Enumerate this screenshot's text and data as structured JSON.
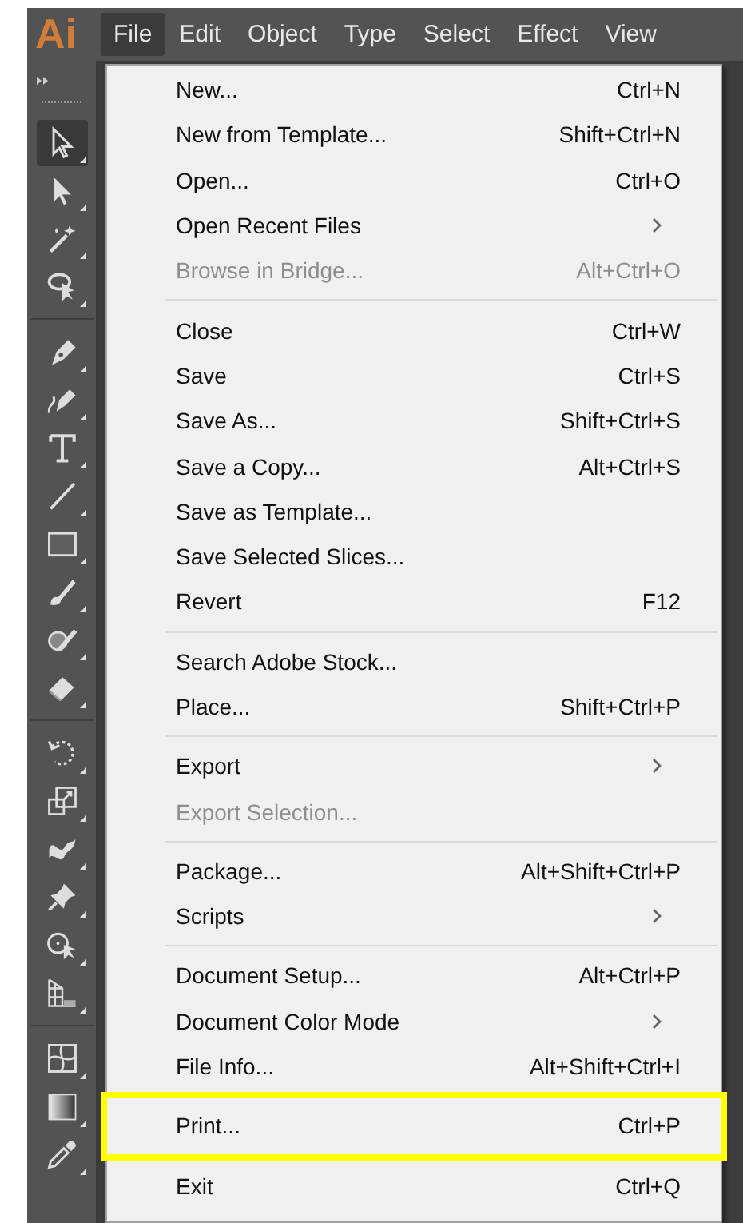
{
  "app_logo": "Ai",
  "menubar": [
    {
      "label": "File",
      "selected": true
    },
    {
      "label": "Edit",
      "selected": false
    },
    {
      "label": "Object",
      "selected": false
    },
    {
      "label": "Type",
      "selected": false
    },
    {
      "label": "Select",
      "selected": false
    },
    {
      "label": "Effect",
      "selected": false
    },
    {
      "label": "View",
      "selected": false
    }
  ],
  "tools": [
    {
      "kind": "selection",
      "selected": true
    },
    {
      "kind": "direct",
      "selected": false
    },
    {
      "kind": "wand",
      "selected": false
    },
    {
      "kind": "lasso",
      "selected": false
    },
    {
      "kind": "sep"
    },
    {
      "kind": "pen",
      "selected": false
    },
    {
      "kind": "curvature",
      "selected": false
    },
    {
      "kind": "type",
      "selected": false
    },
    {
      "kind": "line",
      "selected": false
    },
    {
      "kind": "rect",
      "selected": false
    },
    {
      "kind": "brush",
      "selected": false
    },
    {
      "kind": "shaper",
      "selected": false
    },
    {
      "kind": "eraser",
      "selected": false
    },
    {
      "kind": "sep"
    },
    {
      "kind": "rotate",
      "selected": false
    },
    {
      "kind": "scale",
      "selected": false
    },
    {
      "kind": "warp",
      "selected": false
    },
    {
      "kind": "pin",
      "selected": false
    },
    {
      "kind": "builder",
      "selected": false
    },
    {
      "kind": "perspective",
      "selected": false
    },
    {
      "kind": "sep"
    },
    {
      "kind": "mesh",
      "selected": false
    },
    {
      "kind": "gradient",
      "selected": false
    },
    {
      "kind": "eyedropper",
      "selected": false
    }
  ],
  "file_menu": [
    [
      {
        "label": "New...",
        "shortcut": "Ctrl+N",
        "disabled": false,
        "submenu": false,
        "highlighted": false
      },
      {
        "label": "New from Template...",
        "shortcut": "Shift+Ctrl+N",
        "disabled": false,
        "submenu": false,
        "highlighted": false
      },
      {
        "label": "Open...",
        "shortcut": "Ctrl+O",
        "disabled": false,
        "submenu": false,
        "highlighted": false
      },
      {
        "label": "Open Recent Files",
        "disabled": false,
        "submenu": true,
        "highlighted": false
      },
      {
        "label": "Browse in Bridge...",
        "shortcut": "Alt+Ctrl+O",
        "disabled": true,
        "submenu": false,
        "highlighted": false
      }
    ],
    [
      {
        "label": "Close",
        "shortcut": "Ctrl+W",
        "disabled": false,
        "submenu": false,
        "highlighted": false
      },
      {
        "label": "Save",
        "shortcut": "Ctrl+S",
        "disabled": false,
        "submenu": false,
        "highlighted": false
      },
      {
        "label": "Save As...",
        "shortcut": "Shift+Ctrl+S",
        "disabled": false,
        "submenu": false,
        "highlighted": false
      },
      {
        "label": "Save a Copy...",
        "shortcut": "Alt+Ctrl+S",
        "disabled": false,
        "submenu": false,
        "highlighted": false
      },
      {
        "label": "Save as Template...",
        "disabled": false,
        "submenu": false,
        "highlighted": false
      },
      {
        "label": "Save Selected Slices...",
        "disabled": false,
        "submenu": false,
        "highlighted": false
      },
      {
        "label": "Revert",
        "shortcut": "F12",
        "disabled": false,
        "submenu": false,
        "highlighted": false
      }
    ],
    [
      {
        "label": "Search Adobe Stock...",
        "disabled": false,
        "submenu": false,
        "highlighted": false
      },
      {
        "label": "Place...",
        "shortcut": "Shift+Ctrl+P",
        "disabled": false,
        "submenu": false,
        "highlighted": false
      }
    ],
    [
      {
        "label": "Export",
        "disabled": false,
        "submenu": true,
        "highlighted": false
      },
      {
        "label": "Export Selection...",
        "disabled": true,
        "submenu": false,
        "highlighted": false
      }
    ],
    [
      {
        "label": "Package...",
        "shortcut": "Alt+Shift+Ctrl+P",
        "disabled": false,
        "submenu": false,
        "highlighted": false
      },
      {
        "label": "Scripts",
        "disabled": false,
        "submenu": true,
        "highlighted": false
      }
    ],
    [
      {
        "label": "Document Setup...",
        "shortcut": "Alt+Ctrl+P",
        "disabled": false,
        "submenu": false,
        "highlighted": false
      },
      {
        "label": "Document Color Mode",
        "disabled": false,
        "submenu": true,
        "highlighted": false
      },
      {
        "label": "File Info...",
        "shortcut": "Alt+Shift+Ctrl+I",
        "disabled": false,
        "submenu": false,
        "highlighted": false
      }
    ],
    [
      {
        "label": "Print...",
        "shortcut": "Ctrl+P",
        "disabled": false,
        "submenu": false,
        "highlighted": true
      }
    ],
    [
      {
        "label": "Exit",
        "shortcut": "Ctrl+Q",
        "disabled": false,
        "submenu": false,
        "highlighted": false
      }
    ]
  ]
}
